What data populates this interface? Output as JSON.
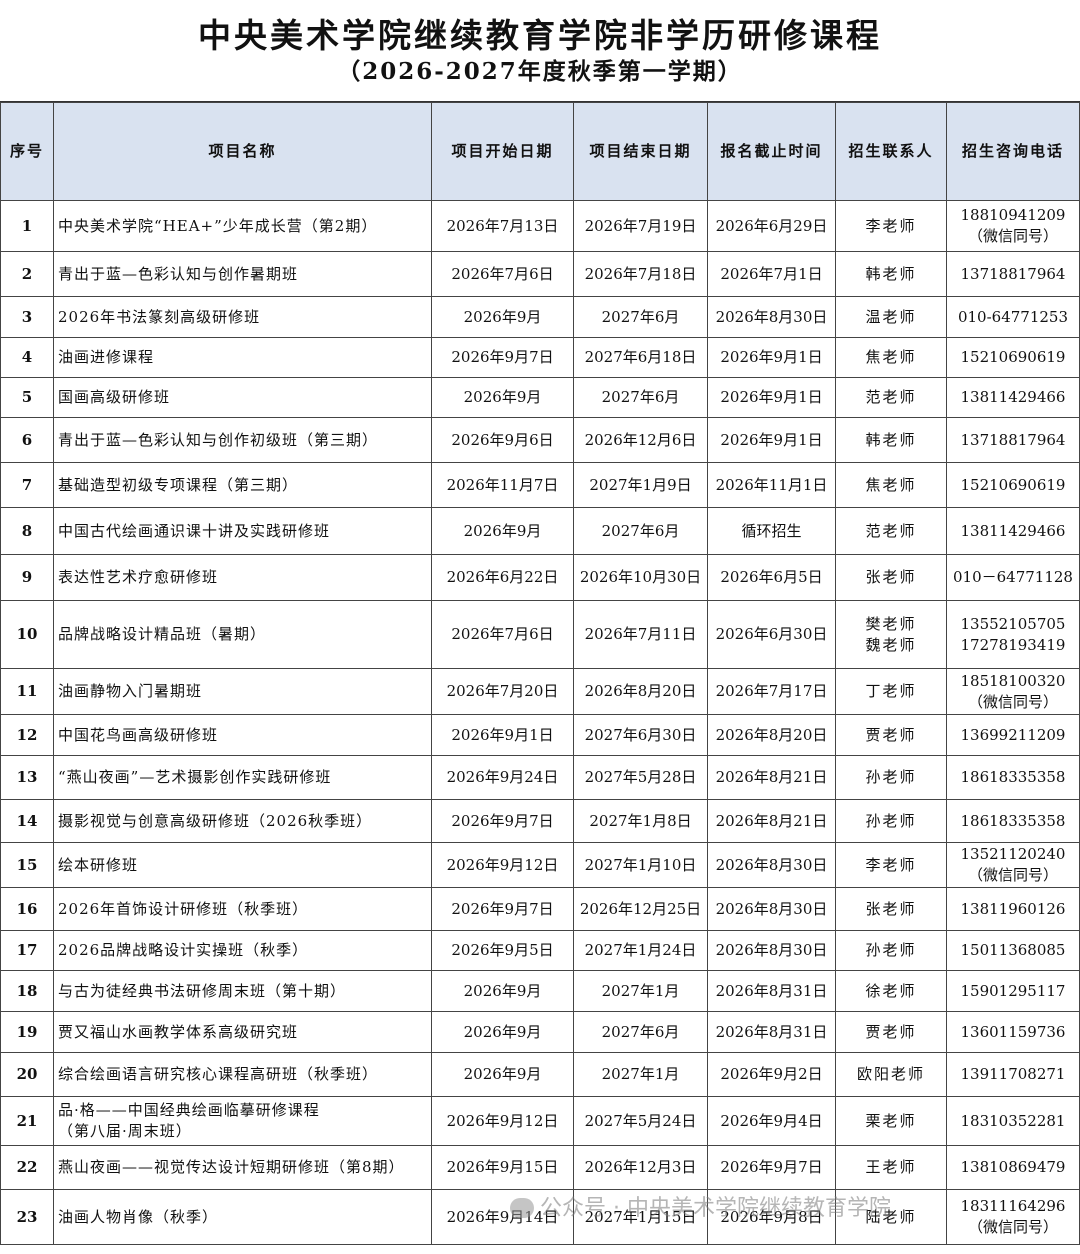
{
  "title": "中央美术学院继续教育学院非学历研修课程",
  "subtitle": "（2026-2027年度秋季第一学期）",
  "columns": [
    "序号",
    "项目名称",
    "项目开始日期",
    "项目结束日期",
    "报名截止时间",
    "招生联系人",
    "招生咨询电话"
  ],
  "rows": [
    {
      "no": "1",
      "name": "中央美术学院“HEA+”少年成长营（第2期）",
      "name2": "",
      "start": "2026年7月13日",
      "end": "2026年7月19日",
      "deadline": "2026年6月29日",
      "contact": "李老师",
      "contact2": "",
      "phone": "18810941209",
      "phone2": "（微信同号）"
    },
    {
      "no": "2",
      "name": "青出于蓝—色彩认知与创作暑期班",
      "name2": "",
      "start": "2026年7月6日",
      "end": "2026年7月18日",
      "deadline": "2026年7月1日",
      "contact": "韩老师",
      "contact2": "",
      "phone": "13718817964",
      "phone2": ""
    },
    {
      "no": "3",
      "name": "2026年书法篆刻高级研修班",
      "name2": "",
      "start": "2026年9月",
      "end": "2027年6月",
      "deadline": "2026年8月30日",
      "contact": "温老师",
      "contact2": "",
      "phone": "010-64771253",
      "phone2": ""
    },
    {
      "no": "4",
      "name": "油画进修课程",
      "name2": "",
      "start": "2026年9月7日",
      "end": "2027年6月18日",
      "deadline": "2026年9月1日",
      "contact": "焦老师",
      "contact2": "",
      "phone": "15210690619",
      "phone2": ""
    },
    {
      "no": "5",
      "name": "国画高级研修班",
      "name2": "",
      "start": "2026年9月",
      "end": "2027年6月",
      "deadline": "2026年9月1日",
      "contact": "范老师",
      "contact2": "",
      "phone": "13811429466",
      "phone2": ""
    },
    {
      "no": "6",
      "name": "青出于蓝—色彩认知与创作初级班（第三期）",
      "name2": "",
      "start": "2026年9月6日",
      "end": "2026年12月6日",
      "deadline": "2026年9月1日",
      "contact": "韩老师",
      "contact2": "",
      "phone": "13718817964",
      "phone2": ""
    },
    {
      "no": "7",
      "name": "基础造型初级专项课程（第三期）",
      "name2": "",
      "start": "2026年11月7日",
      "end": "2027年1月9日",
      "deadline": "2026年11月1日",
      "contact": "焦老师",
      "contact2": "",
      "phone": "15210690619",
      "phone2": ""
    },
    {
      "no": "8",
      "name": "中国古代绘画通识课十讲及实践研修班",
      "name2": "",
      "start": "2026年9月",
      "end": "2027年6月",
      "deadline": "循环招生",
      "contact": "范老师",
      "contact2": "",
      "phone": "13811429466",
      "phone2": ""
    },
    {
      "no": "9",
      "name": "表达性艺术疗愈研修班",
      "name2": "",
      "start": "2026年6月22日",
      "end": "2026年10月30日",
      "deadline": "2026年6月5日",
      "contact": "张老师",
      "contact2": "",
      "phone": "010－64771128",
      "phone2": ""
    },
    {
      "no": "10",
      "name": "品牌战略设计精品班（暑期）",
      "name2": "",
      "start": "2026年7月6日",
      "end": "2026年7月11日",
      "deadline": "2026年6月30日",
      "contact": "樊老师",
      "contact2": "魏老师",
      "phone": "13552105705",
      "phone2": "17278193419"
    },
    {
      "no": "11",
      "name": "油画静物入门暑期班",
      "name2": "",
      "start": "2026年7月20日",
      "end": "2026年8月20日",
      "deadline": "2026年7月17日",
      "contact": "丁老师",
      "contact2": "",
      "phone": "18518100320",
      "phone2": "（微信同号）"
    },
    {
      "no": "12",
      "name": "中国花鸟画高级研修班",
      "name2": "",
      "start": "2026年9月1日",
      "end": "2027年6月30日",
      "deadline": "2026年8月20日",
      "contact": "贾老师",
      "contact2": "",
      "phone": "13699211209",
      "phone2": ""
    },
    {
      "no": "13",
      "name": "“燕山夜画”—艺术摄影创作实践研修班",
      "name2": "",
      "start": "2026年9月24日",
      "end": "2027年5月28日",
      "deadline": "2026年8月21日",
      "contact": "孙老师",
      "contact2": "",
      "phone": "18618335358",
      "phone2": ""
    },
    {
      "no": "14",
      "name": "摄影视觉与创意高级研修班（2026秋季班）",
      "name2": "",
      "start": "2026年9月7日",
      "end": "2027年1月8日",
      "deadline": "2026年8月21日",
      "contact": "孙老师",
      "contact2": "",
      "phone": "18618335358",
      "phone2": ""
    },
    {
      "no": "15",
      "name": "绘本研修班",
      "name2": "",
      "start": "2026年9月12日",
      "end": "2027年1月10日",
      "deadline": "2026年8月30日",
      "contact": "李老师",
      "contact2": "",
      "phone": "13521120240",
      "phone2": "（微信同号）"
    },
    {
      "no": "16",
      "name": "2026年首饰设计研修班（秋季班）",
      "name2": "",
      "start": "2026年9月7日",
      "end": "2026年12月25日",
      "deadline": "2026年8月30日",
      "contact": "张老师",
      "contact2": "",
      "phone": "13811960126",
      "phone2": ""
    },
    {
      "no": "17",
      "name": "2026品牌战略设计实操班（秋季）",
      "name2": "",
      "start": "2026年9月5日",
      "end": "2027年1月24日",
      "deadline": "2026年8月30日",
      "contact": "孙老师",
      "contact2": "",
      "phone": "15011368085",
      "phone2": ""
    },
    {
      "no": "18",
      "name": "与古为徒经典书法研修周末班（第十期）",
      "name2": "",
      "start": "2026年9月",
      "end": "2027年1月",
      "deadline": "2026年8月31日",
      "contact": "徐老师",
      "contact2": "",
      "phone": "15901295117",
      "phone2": ""
    },
    {
      "no": "19",
      "name": "贾又福山水画教学体系高级研究班",
      "name2": "",
      "start": "2026年9月",
      "end": "2027年6月",
      "deadline": "2026年8月31日",
      "contact": "贾老师",
      "contact2": "",
      "phone": "13601159736",
      "phone2": ""
    },
    {
      "no": "20",
      "name": "综合绘画语言研究核心课程高研班（秋季班）",
      "name2": "",
      "start": "2026年9月",
      "end": "2027年1月",
      "deadline": "2026年9月2日",
      "contact": "欧阳老师",
      "contact2": "",
      "phone": "13911708271",
      "phone2": ""
    },
    {
      "no": "21",
      "name": "品·格——中国经典绘画临摹研修课程",
      "name2": "（第八届·周末班）",
      "start": "2026年9月12日",
      "end": "2027年5月24日",
      "deadline": "2026年9月4日",
      "contact": "栗老师",
      "contact2": "",
      "phone": "18310352281",
      "phone2": ""
    },
    {
      "no": "22",
      "name": "燕山夜画——视觉传达设计短期研修班（第8期）",
      "name2": "",
      "start": "2026年9月15日",
      "end": "2026年12月3日",
      "deadline": "2026年9月7日",
      "contact": "王老师",
      "contact2": "",
      "phone": "13810869479",
      "phone2": ""
    },
    {
      "no": "23",
      "name": "油画人物肖像（秋季）",
      "name2": "",
      "start": "2026年9月14日",
      "end": "2027年1月15日",
      "deadline": "2026年9月8日",
      "contact": "陆老师",
      "contact2": "",
      "phone": "18311164296",
      "phone2": "（微信同号）"
    }
  ],
  "watermark": "公众号 · 中央美术学院继续教育学院"
}
